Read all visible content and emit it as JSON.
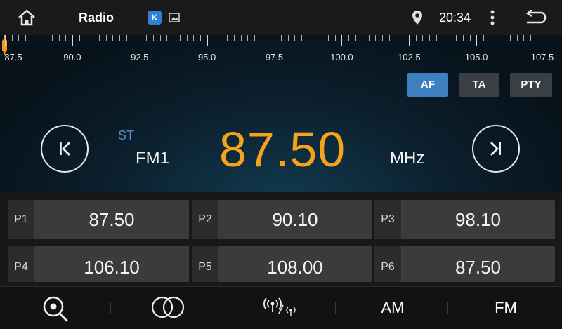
{
  "status_bar": {
    "title": "Radio",
    "app_badge_letter": "K",
    "time": "20:34"
  },
  "tuner": {
    "dial_labels": [
      "87.5",
      "90.0",
      "92.5",
      "95.0",
      "97.5",
      "100.0",
      "102.5",
      "105.0",
      "107.5"
    ],
    "rds_buttons": {
      "af": "AF",
      "ta": "TA",
      "pty": "PTY"
    },
    "stereo": "ST",
    "band": "FM1",
    "frequency": "87.50",
    "unit": "MHz"
  },
  "presets": [
    {
      "label": "P1",
      "value": "87.50"
    },
    {
      "label": "P2",
      "value": "90.10"
    },
    {
      "label": "P3",
      "value": "98.10"
    },
    {
      "label": "P4",
      "value": "106.10"
    },
    {
      "label": "P5",
      "value": "108.00"
    },
    {
      "label": "P6",
      "value": "87.50"
    }
  ],
  "bottom_bar": {
    "am": "AM",
    "fm": "FM",
    "icons": [
      "search-icon",
      "stereo-mono-icon",
      "local-distance-icon"
    ]
  },
  "colors": {
    "frequency": "#f7a21b",
    "af_active": "#3e7fc0",
    "stereo": "#5c86c8"
  }
}
